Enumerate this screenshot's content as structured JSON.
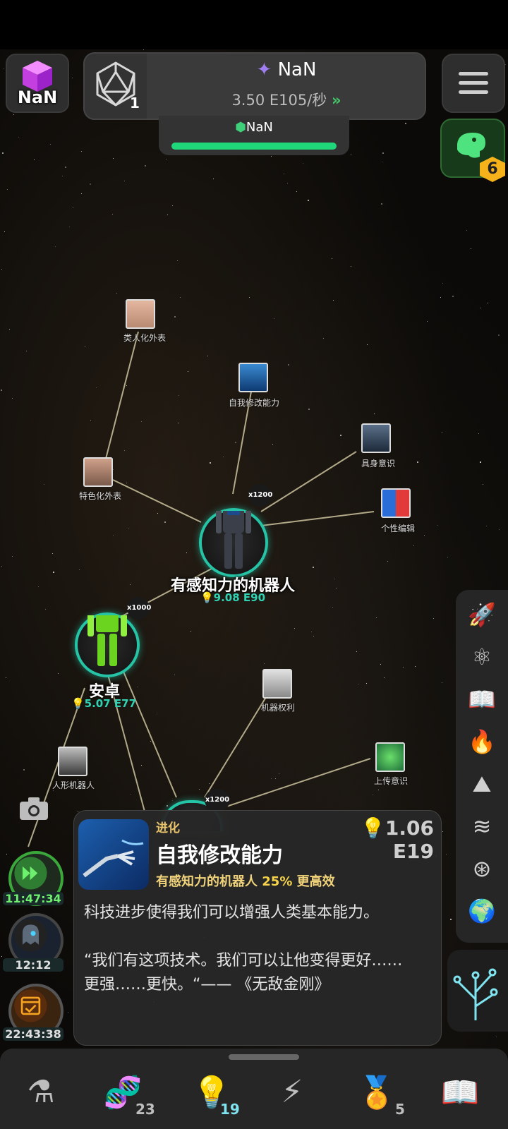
{
  "top": {
    "cube_value": "NaN",
    "d20_count": "1",
    "main_resource": "NaN",
    "rate_text": "3.50 E105/秒",
    "rate_arrows": "»",
    "sub_resource": "NaN",
    "dino_badge": "6"
  },
  "tree": {
    "main_node": {
      "title": "有感知力的机器人",
      "value": "9.08 E90",
      "mult": "x1200"
    },
    "android_node": {
      "title": "安卓",
      "value": "5.07 E77",
      "mult": "x1000"
    },
    "bottom_node_mult": "x1200",
    "small_nodes": [
      {
        "label": "类人化外表"
      },
      {
        "label": "自我修改能力"
      },
      {
        "label": "具身意识"
      },
      {
        "label": "特色化外表"
      },
      {
        "label": "个性编辑"
      },
      {
        "label": "机器权利"
      },
      {
        "label": "人形机器人"
      },
      {
        "label": "上传意识"
      }
    ]
  },
  "timers": [
    {
      "label": "11:47:34"
    },
    {
      "label": "12:12"
    },
    {
      "label": "22:43:38"
    }
  ],
  "popup": {
    "category": "进化",
    "cost": "1.06 E19",
    "title": "自我修改能力",
    "effect_target": "有感知力的机器人",
    "effect_pct": "25%",
    "effect_suffix": "更高效",
    "description": "科技进步使得我们可以增强人类基本能力。\n\n“我们有这项技术。我们可以让他变得更好……更强……更快。“—— 《无敌金刚》"
  },
  "side_icons": [
    "rocket-icon",
    "atom-icon",
    "book-icon",
    "fire-icon",
    "mountain-icon",
    "waves-icon",
    "cell-icon",
    "globe-icon"
  ],
  "bottom_nav": [
    {
      "icon": "flask-icon",
      "count": ""
    },
    {
      "icon": "dna-icon",
      "count": "23"
    },
    {
      "icon": "lightbulb-icon",
      "count": "19"
    },
    {
      "icon": "lightning-icon",
      "count": ""
    },
    {
      "icon": "medal-icon",
      "count": "5"
    },
    {
      "icon": "open-book-icon",
      "count": ""
    }
  ],
  "colors": {
    "accent_teal": "#25c4a6",
    "progress_green": "#1fd67a",
    "gold": "#f6b21b"
  }
}
